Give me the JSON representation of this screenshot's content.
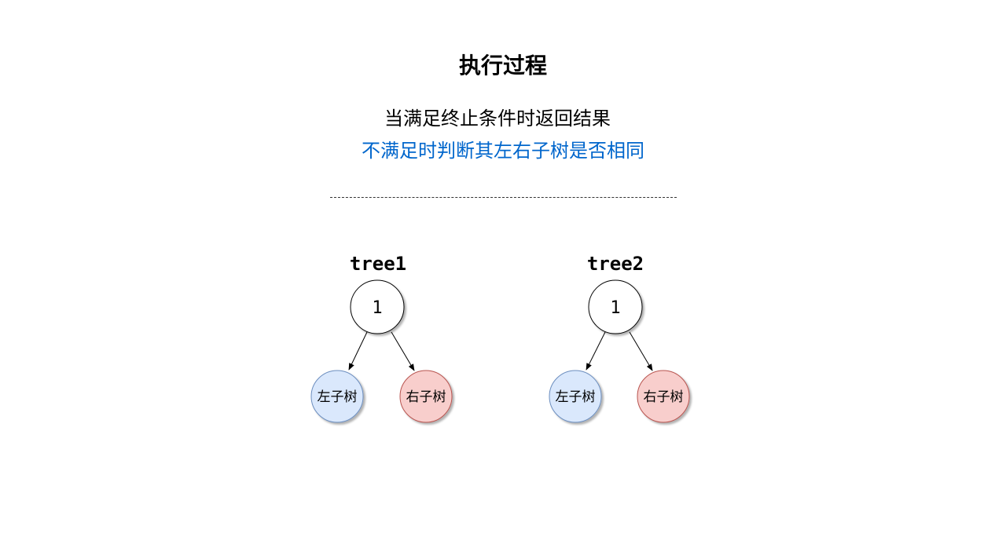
{
  "title": "执行过程",
  "description": {
    "line1": "当满足终止条件时返回结果",
    "line2": "不满足时判断其左右子树是否相同"
  },
  "colors": {
    "highlight_text": "#0066cc",
    "left_subtree_fill": "#dae8fc",
    "left_subtree_stroke": "#6c8ebf",
    "right_subtree_fill": "#f8cecc",
    "right_subtree_stroke": "#b85450",
    "root_fill": "#ffffff",
    "stroke": "#000000"
  },
  "trees": [
    {
      "label": "tree1",
      "root": "1",
      "left": "左子树",
      "right": "右子树"
    },
    {
      "label": "tree2",
      "root": "1",
      "left": "左子树",
      "right": "右子树"
    }
  ]
}
